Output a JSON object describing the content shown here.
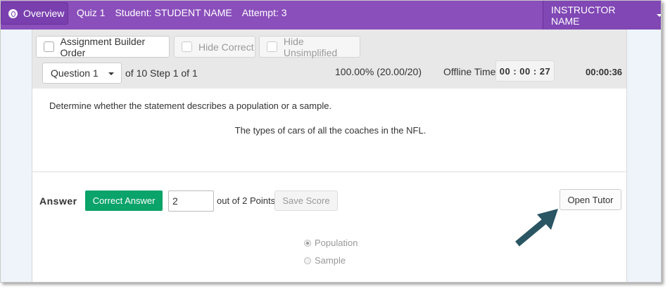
{
  "topbar": {
    "overview_label": "Overview",
    "quiz": "Quiz 1",
    "student": "Student: STUDENT NAME",
    "attempt": "Attempt: 3",
    "instructor": "INSTRUCTOR NAME",
    "color": "#8a4fbb"
  },
  "toolbar": {
    "assignment_builder_order": "Assignment Builder Order",
    "hide_correct": "Hide Correct",
    "hide_unsimplified": "Hide Unsimplified",
    "question_select": "Question 1",
    "step_text": "of 10 Step 1 of 1",
    "score_percent": "100.00% (20.00/20)",
    "offline_label": "Offline Time:",
    "offline_time": "00 : 00 : 27",
    "timer": "00:00:36"
  },
  "question": {
    "prompt": "Determine whether the statement describes a population or a sample.",
    "statement": "The types of cars of all the coaches in the NFL."
  },
  "answer": {
    "label": "Answer",
    "correct_answer_label": "Correct Answer",
    "points_value": "2",
    "out_of": "out of 2 Points",
    "save_score": "Save Score",
    "open_tutor": "Open Tutor",
    "accent_color": "#0aa36a",
    "options": [
      {
        "label": "Population",
        "selected": true
      },
      {
        "label": "Sample",
        "selected": false
      }
    ]
  },
  "annotation": {
    "arrow_color": "#2a5563",
    "arrow_icon": "arrow-pointing-up-right"
  }
}
